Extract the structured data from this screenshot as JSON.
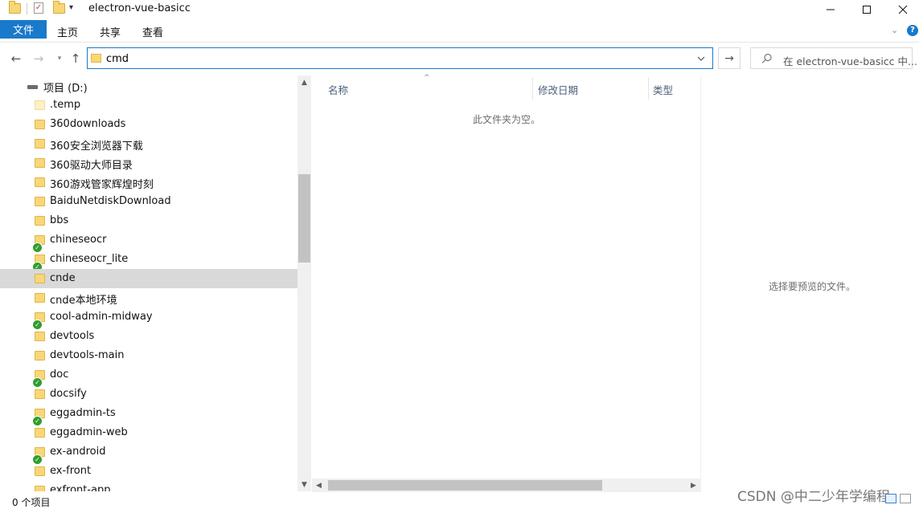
{
  "window": {
    "title": "electron-vue-basicc"
  },
  "ribbon": {
    "tabs": [
      "文件",
      "主页",
      "共享",
      "查看"
    ]
  },
  "address": {
    "path": "cmd"
  },
  "search": {
    "placeholder": "在 electron-vue-basicc 中..."
  },
  "tree": {
    "drive_label": "项目 (D:)",
    "items": [
      {
        "name": ".temp",
        "synced": false,
        "pale": true
      },
      {
        "name": "360downloads",
        "synced": false
      },
      {
        "name": "360安全浏览器下载",
        "synced": false
      },
      {
        "name": "360驱动大师目录",
        "synced": false
      },
      {
        "name": "360游戏管家辉煌时刻",
        "synced": false
      },
      {
        "name": "BaiduNetdiskDownload",
        "synced": false
      },
      {
        "name": "bbs",
        "synced": false
      },
      {
        "name": "chineseocr",
        "synced": true
      },
      {
        "name": "chineseocr_lite",
        "synced": true
      },
      {
        "name": "cnde",
        "synced": false,
        "selected": true
      },
      {
        "name": "cnde本地环境",
        "synced": false
      },
      {
        "name": "cool-admin-midway",
        "synced": true
      },
      {
        "name": "devtools",
        "synced": false
      },
      {
        "name": "devtools-main",
        "synced": false
      },
      {
        "name": "doc",
        "synced": true
      },
      {
        "name": "docsify",
        "synced": false
      },
      {
        "name": "eggadmin-ts",
        "synced": true
      },
      {
        "name": "eggadmin-web",
        "synced": false
      },
      {
        "name": "ex-android",
        "synced": true
      },
      {
        "name": "ex-front",
        "synced": false
      },
      {
        "name": "exfront-app",
        "synced": false
      }
    ]
  },
  "list": {
    "columns": [
      "名称",
      "修改日期",
      "类型"
    ],
    "empty_message": "此文件夹为空。"
  },
  "preview": {
    "message": "选择要预览的文件。"
  },
  "status": {
    "item_count": "0 个项目"
  },
  "watermark": "CSDN @中二少年学编程",
  "colors": {
    "accent": "#1979ca",
    "folder": "#f9d776",
    "selected_row": "#d9d9d9",
    "sync_ok": "#2f9e2f"
  }
}
